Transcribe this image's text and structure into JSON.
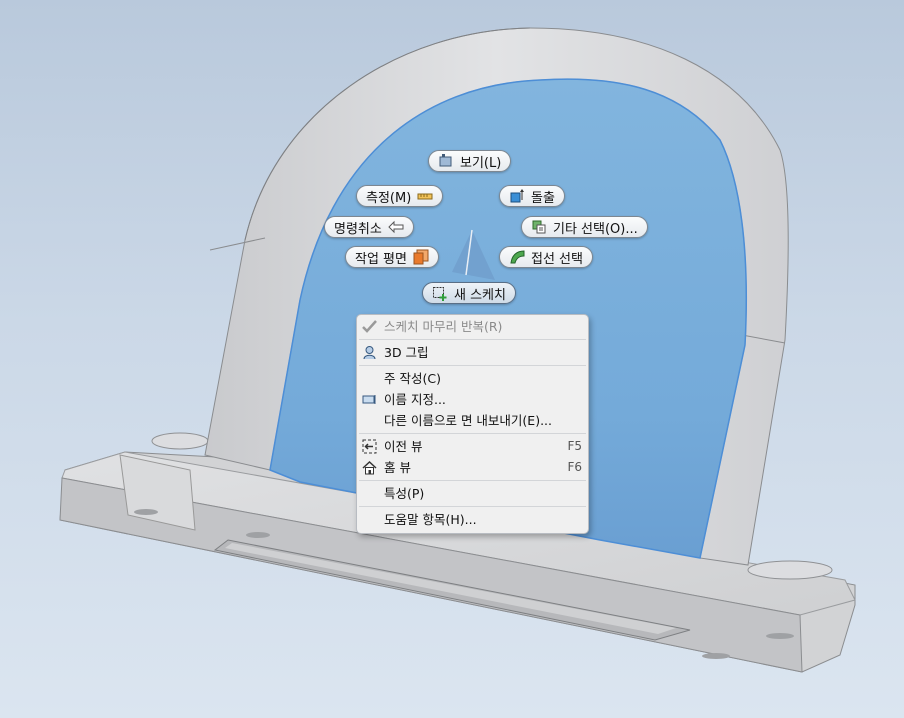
{
  "colors": {
    "face_blue": "#7db2dc",
    "face_edge": "#4d8ed6",
    "model_gray": "#d6d7d9",
    "menu_bg": "#f0f0f0"
  },
  "marking_menu": {
    "view": {
      "label": "보기(L)",
      "icon": "view-cube-icon"
    },
    "measure": {
      "label": "측정(M)",
      "icon": "ruler-icon"
    },
    "extrude": {
      "label": "돌출",
      "icon": "extrude-icon"
    },
    "undo": {
      "label": "명령취소",
      "icon": "undo-arrow-icon"
    },
    "select_other": {
      "label": "기타 선택(O)...",
      "icon": "select-other-icon"
    },
    "work_plane": {
      "label": "작업 평면",
      "icon": "work-plane-icon"
    },
    "tangent_select": {
      "label": "접선 선택",
      "icon": "tangent-select-icon"
    },
    "new_sketch": {
      "label": "새 스케치",
      "icon": "new-sketch-icon"
    }
  },
  "context_menu": {
    "repeat_finish_sketch": {
      "label": "스케치 마무리 반복(R)",
      "icon": "checkmark-icon",
      "enabled": false
    },
    "grip_3d": {
      "label": "3D 그립",
      "icon": "grip-icon"
    },
    "create_note": {
      "label": "주 작성(C)"
    },
    "naming": {
      "label": "이름 지정...",
      "icon": "naming-icon"
    },
    "export_face_as": {
      "label": "다른 이름으로 면 내보내기(E)..."
    },
    "previous_view": {
      "label": "이전 뷰",
      "shortcut": "F5",
      "icon": "previous-view-icon"
    },
    "home_view": {
      "label": "홈 뷰",
      "shortcut": "F6",
      "icon": "home-icon"
    },
    "properties": {
      "label": "특성(P)"
    },
    "help_topics": {
      "label": "도움말 항목(H)..."
    }
  }
}
